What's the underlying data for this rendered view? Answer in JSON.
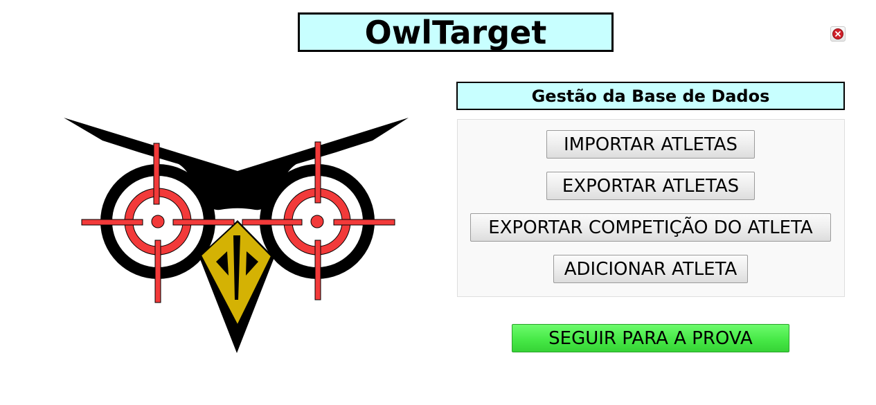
{
  "app": {
    "title": "OwlTarget"
  },
  "window": {
    "close_icon": "close-circle-icon",
    "close_color": "#d0202a"
  },
  "logo": {
    "icon": "owl-target-logo",
    "colors": {
      "black": "#000000",
      "red": "#f23a3a",
      "beak": "#d4b204"
    }
  },
  "database_section": {
    "title": "Gestão da Base de Dados",
    "header_color": "#c8ffff",
    "buttons": {
      "import": "IMPORTAR ATLETAS",
      "export": "EXPORTAR ATLETAS",
      "export_competition": "EXPORTAR COMPETIÇÃO DO ATLETA",
      "add": "ADICIONAR ATLETA"
    }
  },
  "proceed": {
    "label": "SEGUIR PARA A PROVA",
    "color": "#47e947"
  }
}
